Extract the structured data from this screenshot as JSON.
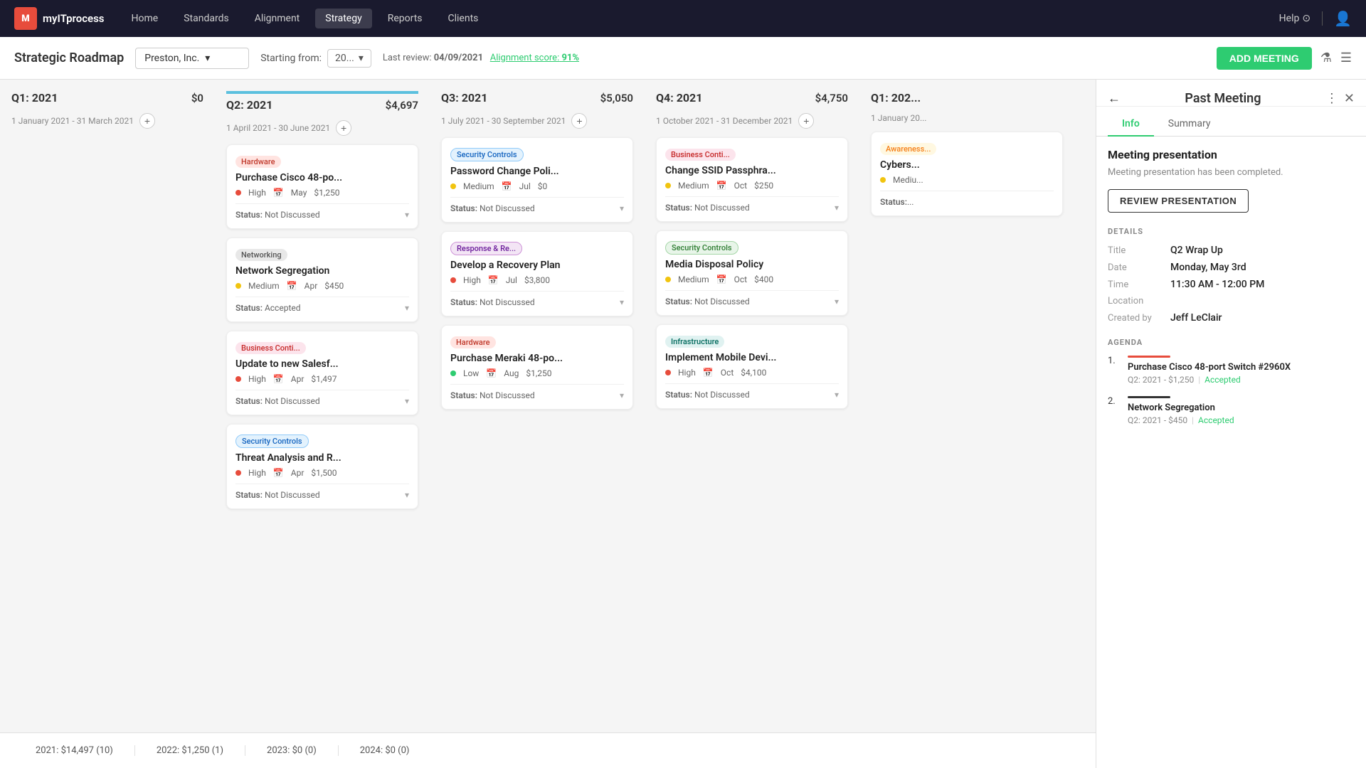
{
  "nav": {
    "logo_text": "myITprocess",
    "items": [
      "Home",
      "Standards",
      "Alignment",
      "Strategy",
      "Reports",
      "Clients"
    ],
    "active": "Strategy",
    "help": "Help",
    "help_icon": "?"
  },
  "subheader": {
    "title": "Strategic Roadmap",
    "client": "Preston, Inc.",
    "starting_from_label": "Starting from:",
    "year": "20...",
    "last_review_label": "Last review:",
    "last_review_date": "04/09/2021",
    "alignment_label": "Alignment score:",
    "alignment_value": "91%",
    "add_meeting_label": "ADD MEETING"
  },
  "quarters": [
    {
      "id": "q1-2021",
      "title": "Q1: 2021",
      "amount": "$0",
      "dates": "1 January 2021 - 31 March 2021",
      "cards": []
    },
    {
      "id": "q2-2021",
      "title": "Q2: 2021",
      "amount": "$4,697",
      "dates": "1 April 2021 - 30 June 2021",
      "cards": [
        {
          "tag": "Hardware",
          "tag_class": "tag-hardware",
          "title": "Purchase Cisco 48-po...",
          "priority": "High",
          "priority_class": "dot-red",
          "month": "May",
          "cost": "$1,250",
          "status": "Not Discussed"
        },
        {
          "tag": "Networking",
          "tag_class": "tag-networking",
          "title": "Network Segregation",
          "priority": "Medium",
          "priority_class": "dot-yellow",
          "month": "Apr",
          "cost": "$450",
          "status": "Accepted"
        },
        {
          "tag": "Business Conti...",
          "tag_class": "tag-business",
          "title": "Update to new Salesf...",
          "priority": "High",
          "priority_class": "dot-red",
          "month": "Apr",
          "cost": "$1,497",
          "status": "Not Discussed"
        },
        {
          "tag": "Security Controls",
          "tag_class": "tag-security",
          "title": "Threat Analysis and R...",
          "priority": "High",
          "priority_class": "dot-red",
          "month": "Apr",
          "cost": "$1,500",
          "status": "Not Discussed"
        }
      ]
    },
    {
      "id": "q3-2021",
      "title": "Q3: 2021",
      "amount": "$5,050",
      "dates": "1 July 2021 - 30 September 2021",
      "cards": [
        {
          "tag": "Security Controls",
          "tag_class": "tag-security",
          "title": "Password Change Poli...",
          "priority": "Medium",
          "priority_class": "dot-yellow",
          "month": "Jul",
          "cost": "$0",
          "status": "Not Discussed"
        },
        {
          "tag": "Response & Re...",
          "tag_class": "tag-response",
          "title": "Develop a Recovery Plan",
          "priority": "High",
          "priority_class": "dot-red",
          "month": "Jul",
          "cost": "$3,800",
          "status": "Not Discussed"
        },
        {
          "tag": "Hardware",
          "tag_class": "tag-hardware",
          "title": "Purchase Meraki 48-po...",
          "priority": "Low",
          "priority_class": "dot-green",
          "month": "Aug",
          "cost": "$1,250",
          "status": "Not Discussed"
        }
      ]
    },
    {
      "id": "q4-2021",
      "title": "Q4: 2021",
      "amount": "$4,750",
      "dates": "1 October 2021 - 31 December 2021",
      "cards": [
        {
          "tag": "Business Conti...",
          "tag_class": "tag-business",
          "title": "Change SSID Passphra...",
          "priority": "Medium",
          "priority_class": "dot-yellow",
          "month": "Oct",
          "cost": "$250",
          "status": "Not Discussed"
        },
        {
          "tag": "Security Controls",
          "tag_class": "tag-security-green",
          "title": "Media Disposal Policy",
          "priority": "Medium",
          "priority_class": "dot-yellow",
          "month": "Oct",
          "cost": "$400",
          "status": "Not Discussed"
        },
        {
          "tag": "Infrastructure",
          "tag_class": "tag-infra",
          "title": "Implement Mobile Devi...",
          "priority": "High",
          "priority_class": "dot-red",
          "month": "Oct",
          "cost": "$4,100",
          "status": "Not Discussed"
        }
      ]
    },
    {
      "id": "q1-2022",
      "title": "Q1: 202...",
      "amount": "",
      "dates": "1 January 20...",
      "cards": [
        {
          "tag": "Awareness...",
          "tag_class": "tag-awareness",
          "title": "Cybers...",
          "priority": "Medium",
          "priority_class": "dot-yellow",
          "month": "",
          "cost": "",
          "status": "Status:..."
        }
      ]
    }
  ],
  "bottom_bar": [
    {
      "label": "2021: $14,497 (10)"
    },
    {
      "label": "2022: $1,250 (1)"
    },
    {
      "label": "2023: $0 (0)"
    },
    {
      "label": "2024: $0 (0)"
    }
  ],
  "panel": {
    "back_icon": "←",
    "title": "Past Meeting",
    "more_icon": "⋮",
    "close_icon": "✕",
    "tabs": [
      "Info",
      "Summary"
    ],
    "active_tab": "Info",
    "meeting_presentation_title": "Meeting presentation",
    "meeting_presentation_sub": "Meeting presentation has been completed.",
    "review_btn_label": "REVIEW PRESENTATION",
    "details_title": "Details",
    "detail_rows": [
      {
        "key": "Title",
        "val": "Q2 Wrap Up"
      },
      {
        "key": "Date",
        "val": "Monday, May 3rd"
      },
      {
        "key": "Time",
        "val": "11:30 AM - 12:00 PM"
      },
      {
        "key": "Location",
        "val": ""
      },
      {
        "key": "Created by",
        "val": "Jeff LeClair"
      }
    ],
    "agenda_title": "Agenda",
    "agenda_items": [
      {
        "num": "1.",
        "bar_class": "agenda-bar",
        "title": "Purchase Cisco 48-port Switch #2960X",
        "sub": "Q2: 2021 - $1,250",
        "status": "Accepted"
      },
      {
        "num": "2.",
        "bar_class": "agenda-bar-dark",
        "title": "Network Segregation",
        "sub": "Q2: 2021 - $450",
        "status": "Accepted"
      }
    ]
  }
}
